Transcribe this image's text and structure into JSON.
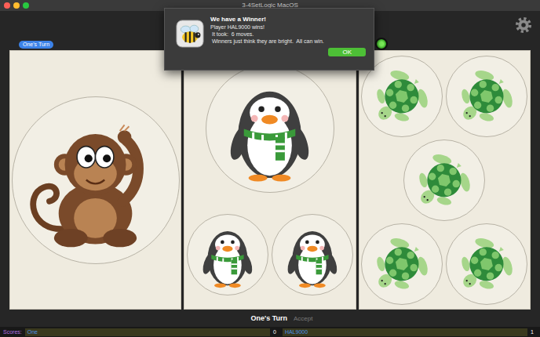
{
  "window": {
    "title": "3-4SetLogic MacOS"
  },
  "turn_badge": "One's Turn",
  "indicator": {
    "on": true
  },
  "panels": [
    {
      "figures": [
        {
          "kind": "monkey",
          "big": true
        }
      ]
    },
    {
      "figures": [
        {
          "kind": "penguin",
          "big": true
        },
        {
          "kind": "penguin",
          "big": false
        },
        {
          "kind": "penguin",
          "big": false
        }
      ]
    },
    {
      "figures": [
        {
          "kind": "turtle",
          "big": false
        },
        {
          "kind": "turtle",
          "big": false
        },
        {
          "kind": "turtle",
          "big": false
        },
        {
          "kind": "turtle",
          "big": false
        },
        {
          "kind": "turtle",
          "big": false
        }
      ]
    }
  ],
  "turn_label": "One's Turn",
  "accept": {
    "label": "Accept",
    "disabled": true
  },
  "scores": {
    "label": "Scores:",
    "players": [
      {
        "name": "One",
        "score": "0"
      },
      {
        "name": "HAL9000",
        "score": "1"
      }
    ]
  },
  "dialog": {
    "title": "We have a Winner!",
    "lines": [
      "Player HAL9000 wins!",
      " It took:  6 moves.",
      " Winners just think they are bright.  All can win."
    ],
    "button": "OK"
  }
}
